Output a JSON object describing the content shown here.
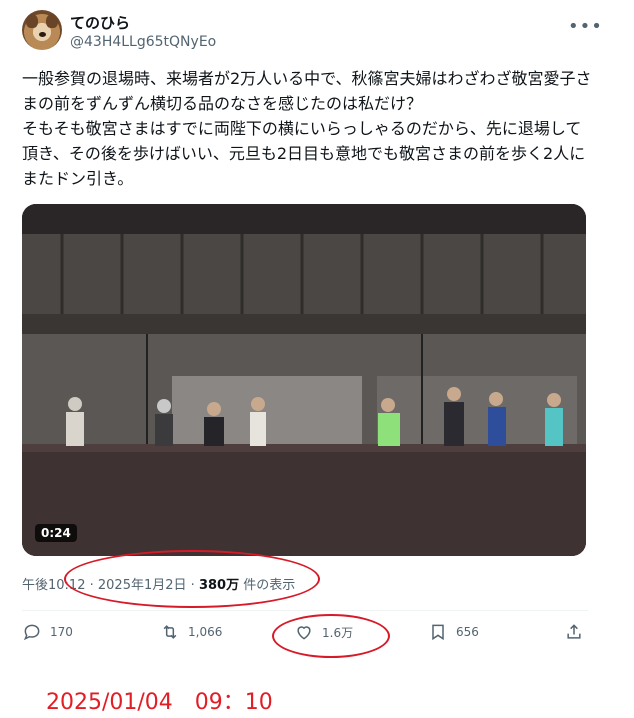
{
  "author": {
    "display_name": "てのひら",
    "handle": "@43H4LLg65tQNyEo",
    "avatar_icon": "dog-avatar-icon"
  },
  "more_icon": "more-horizontal-icon",
  "tweet": {
    "text": "一般参賀の退場時、来場者が2万人いる中で、秋篠宮夫婦はわざわざ敬宮愛子さまの前をずんずん横切る品のなさを感じたのは私だけ？\nそもそも敬宮さまはすでに両陛下の横にいらっしゃるのだから、先に退場して頂き、その後を歩けばいい、元旦も2日目も意地でも敬宮さまの前を歩く2人にまたドン引き。"
  },
  "media": {
    "duration": "0:24"
  },
  "meta": {
    "time": "午後10:12",
    "separator": "·",
    "date": "2025年1月2日",
    "views_count": "380万",
    "views_label": "件の表示"
  },
  "actions": {
    "reply_count": "170",
    "retweet_count": "1,066",
    "like_count": "1.6万",
    "bookmark_count": "656",
    "icons": [
      "reply-icon",
      "retweet-icon",
      "like-icon",
      "bookmark-icon",
      "share-icon"
    ]
  },
  "annotation": {
    "stamp_text": "2025/01/04　09：10",
    "stroke_color": "#d61a28"
  }
}
